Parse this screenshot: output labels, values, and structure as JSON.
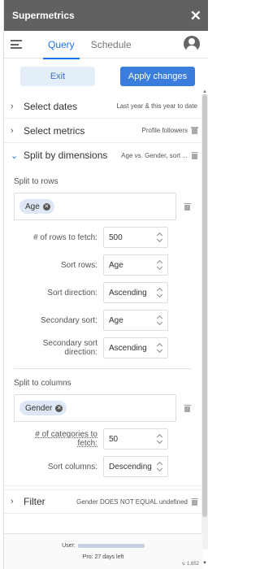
{
  "app": {
    "title": "Supermetrics",
    "close_glyph": "✕"
  },
  "tabs": [
    {
      "label": "Query",
      "active": true
    },
    {
      "label": "Schedule",
      "active": false
    }
  ],
  "actions": {
    "exit_label": "Exit",
    "apply_label": "Apply changes"
  },
  "sections": {
    "dates": {
      "label": "Select dates",
      "summary": "Last year & this year to date"
    },
    "metrics": {
      "label": "Select metrics",
      "summary": "Profile followers"
    },
    "split": {
      "label": "Split by dimensions",
      "summary": "Age vs. Gender, sort ..."
    },
    "filter": {
      "label": "Filter",
      "summary": "Gender DOES NOT EQUAL undefined"
    }
  },
  "split_rows": {
    "label": "Split to rows",
    "chip": "Age",
    "options": [
      {
        "label": "# of rows to fetch:",
        "value": "500"
      },
      {
        "label": "Sort rows:",
        "value": "Age"
      },
      {
        "label": "Sort direction:",
        "value": "Ascending"
      },
      {
        "label": "Secondary sort:",
        "value": "Age"
      },
      {
        "label": "Secondary sort direction:",
        "value": "Ascending"
      }
    ]
  },
  "split_columns": {
    "label": "Split to columns",
    "chip": "Gender",
    "options": [
      {
        "label": "# of categories to fetch:",
        "value": "50"
      },
      {
        "label": "Sort columns:",
        "value": "Descending"
      }
    ]
  },
  "footer": {
    "user_label": "User:",
    "pro": "Pro: 27 days left",
    "version": "v. 1.652"
  },
  "icons": [
    "hamburger-icon",
    "account-icon",
    "chevron-right-icon",
    "chevron-down-icon",
    "trash-icon",
    "chip-remove-icon",
    "select-arrows-icon"
  ]
}
